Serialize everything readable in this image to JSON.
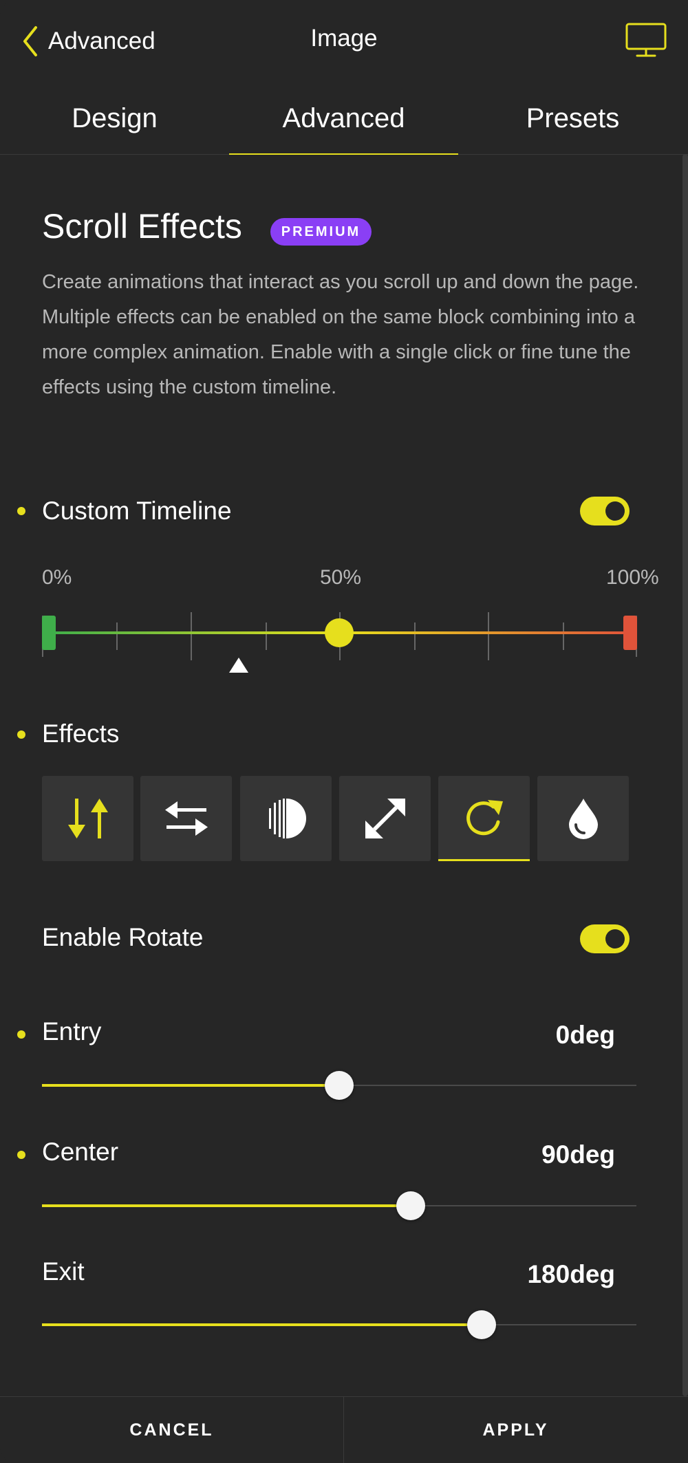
{
  "header": {
    "back_label": "Advanced",
    "title": "Image",
    "device_icon": "monitor-icon"
  },
  "tabs": [
    {
      "label": "Design",
      "active": false
    },
    {
      "label": "Advanced",
      "active": true
    },
    {
      "label": "Presets",
      "active": false
    }
  ],
  "section": {
    "title": "Scroll Effects",
    "badge": "PREMIUM",
    "description": "Create animations that interact as you scroll up and down the page. Multiple effects can be enabled on the same block combining into a more complex animation. Enable with a single click or fine tune the effects using the custom timeline."
  },
  "custom_timeline": {
    "label": "Custom Timeline",
    "enabled": true,
    "ticks": {
      "start": "0%",
      "middle": "50%",
      "end": "100%"
    },
    "center_percent": 50,
    "marker_percent": 33
  },
  "effects": {
    "label": "Effects",
    "items": [
      {
        "icon": "vertical-arrows-icon",
        "active": false
      },
      {
        "icon": "horizontal-arrows-icon",
        "active": false
      },
      {
        "icon": "opacity-circle-icon",
        "active": false
      },
      {
        "icon": "scale-arrows-icon",
        "active": false
      },
      {
        "icon": "rotate-icon",
        "active": true
      },
      {
        "icon": "blur-drop-icon",
        "active": false
      }
    ]
  },
  "rotate": {
    "label": "Enable Rotate",
    "enabled": true,
    "entry": {
      "label": "Entry",
      "value": "0deg",
      "fraction": 0.5
    },
    "center": {
      "label": "Center",
      "value": "90deg",
      "fraction": 0.62
    },
    "exit": {
      "label": "Exit",
      "value": "180deg",
      "fraction": 0.74
    }
  },
  "footer": {
    "cancel": "CANCEL",
    "apply": "APPLY"
  },
  "colors": {
    "accent": "#e6df1d",
    "premium": "#8a3ff5",
    "background": "#262626"
  }
}
